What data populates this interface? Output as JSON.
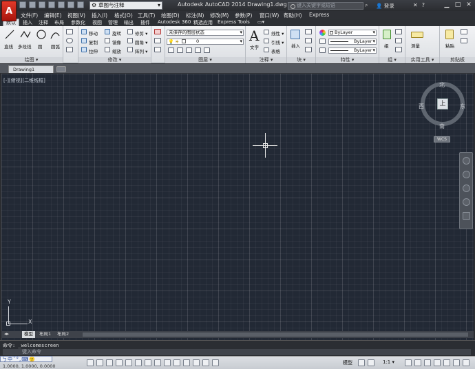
{
  "app": {
    "logo_letter": "A",
    "title": "Autodesk AutoCAD 2014    Drawing1.dwg",
    "workspace": "草图与注释",
    "search_placeholder": "键入关键字或短语",
    "login": "登录"
  },
  "menu": [
    "文件(F)",
    "编辑(E)",
    "视图(V)",
    "插入(I)",
    "格式(O)",
    "工具(T)",
    "绘图(D)",
    "标注(N)",
    "修改(M)",
    "参数(P)",
    "窗口(W)",
    "帮助(H)",
    "Express"
  ],
  "ribbon_tabs": [
    "默认",
    "插入",
    "注释",
    "布局",
    "参数化",
    "视图",
    "管理",
    "输出",
    "插件",
    "Autodesk 360",
    "精选应用",
    "Express Tools",
    "▭▾"
  ],
  "ribbon": {
    "draw": {
      "title": "绘图 ▾",
      "line": "直线",
      "polyline": "多段线",
      "circle": "圆",
      "arc": "圆弧"
    },
    "modify": {
      "title": "修改 ▾",
      "move": "移动",
      "rotate": "旋转",
      "trim": "修剪 ▾",
      "copy": "复制",
      "mirror": "镜像",
      "fillet": "圆角 ▾",
      "stretch": "拉伸",
      "scale": "缩放",
      "array": "阵列 ▾"
    },
    "layers": {
      "title": "图层 ▾",
      "state": "未保存的图层状态",
      "current": "0"
    },
    "annotation": {
      "title": "注释 ▾",
      "text": "文字",
      "dimension": "线性 ▾",
      "leader": "引线 ▾",
      "table": "表格"
    },
    "block": {
      "title": "块 ▾",
      "insert": "插入"
    },
    "properties": {
      "title": "特性 ▾",
      "color": "ByLayer",
      "linetype": "ByLayer",
      "lineweight": "ByLayer"
    },
    "groups": {
      "title": "组 ▾",
      "group": "组"
    },
    "utilities": {
      "title": "实用工具 ▾",
      "measure": "测量"
    },
    "clipboard": {
      "title": "剪贴板",
      "paste": "粘贴"
    }
  },
  "doc_tab": "Drawing1",
  "viewport": {
    "label": "[-][俯视][二维线框]",
    "viewcube": {
      "top": "上",
      "north": "北",
      "south": "南",
      "east": "东",
      "west": "西"
    },
    "wcs": "WCS",
    "ucs_x": "X",
    "ucs_y": "Y"
  },
  "layout_tabs": [
    "模型",
    "布局1",
    "布局2"
  ],
  "command": {
    "history": "命令: _welcomescreen",
    "prompt": "键入命令"
  },
  "status": {
    "coords": "1.0000, 1.0000, 0.0000",
    "model": "模型",
    "scale": "1:1 ▾",
    "ime": "ㄅ中ˇ°,⌨🙂"
  },
  "colors": {
    "accent": "#c8241a",
    "canvas": "#222935",
    "ribbon": "#e6e8eb"
  }
}
